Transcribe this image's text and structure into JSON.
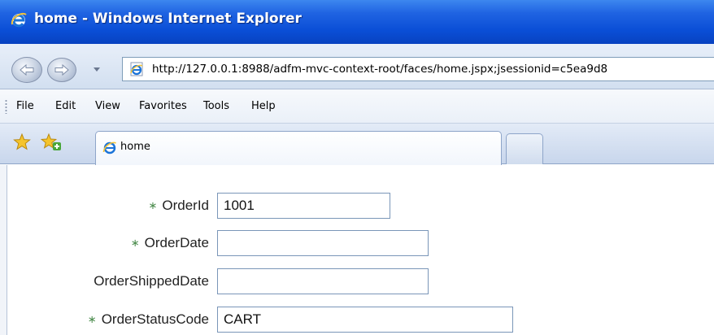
{
  "window": {
    "title": "home - Windows Internet Explorer",
    "brand_color": "#0a4ed6"
  },
  "addressbar": {
    "url": "http://127.0.0.1:8988/adfm-mvc-context-root/faces/home.jspx;jsessionid=c5ea9d8"
  },
  "menu": {
    "file": "File",
    "edit": "Edit",
    "view": "View",
    "favorites": "Favorites",
    "tools": "Tools",
    "help": "Help"
  },
  "tabs": {
    "active_label": "home"
  },
  "form": {
    "required_marker": "∗",
    "required_color": "#4f8f51",
    "fields": [
      {
        "label": "OrderId",
        "value": "1001",
        "required": true
      },
      {
        "label": "OrderDate",
        "value": "",
        "required": true
      },
      {
        "label": "OrderShippedDate",
        "value": "",
        "required": false
      },
      {
        "label": "OrderStatusCode",
        "value": "CART",
        "required": true
      }
    ]
  }
}
